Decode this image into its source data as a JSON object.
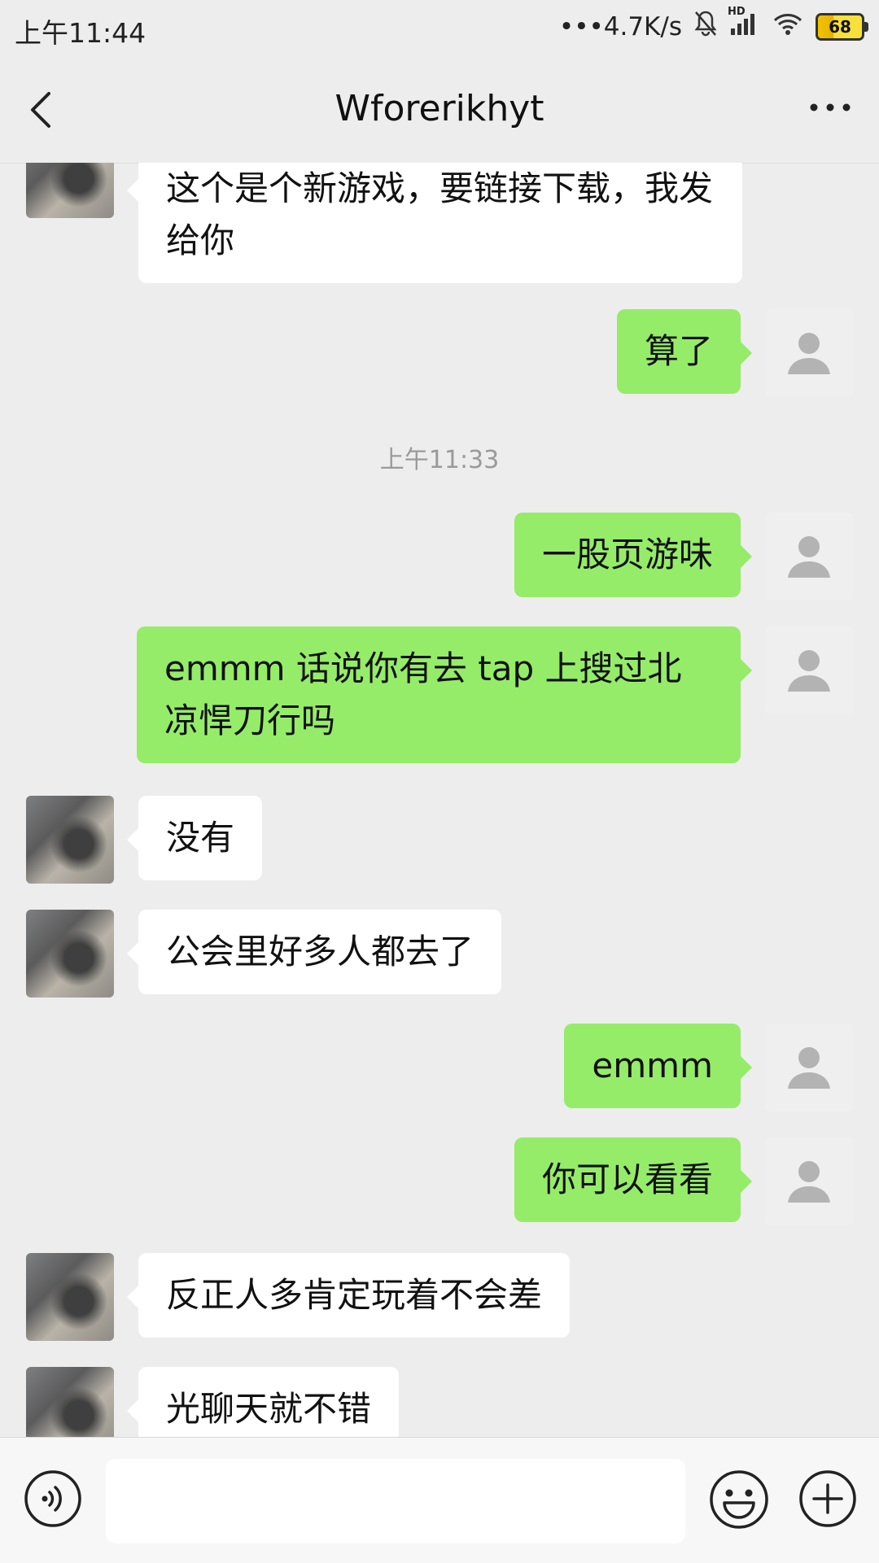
{
  "status": {
    "time": "上午11:44",
    "speed": "•••4.7K/s",
    "hd": "HD",
    "battery": "68"
  },
  "header": {
    "title": "Wforerikhyt"
  },
  "messages": [
    {
      "side": "left",
      "text": "这个是个新游戏，要链接下载，我发给你"
    },
    {
      "side": "right",
      "text": "算了"
    },
    {
      "timestamp": "上午11:33"
    },
    {
      "side": "right",
      "text": "一股页游味"
    },
    {
      "side": "right",
      "text": "emmm  话说你有去 tap 上搜过北凉悍刀行吗"
    },
    {
      "side": "left",
      "text": "没有"
    },
    {
      "side": "left",
      "text": "公会里好多人都去了"
    },
    {
      "side": "right",
      "text": "emmm"
    },
    {
      "side": "right",
      "text": "你可以看看"
    },
    {
      "side": "left",
      "text": "反正人多肯定玩着不会差"
    },
    {
      "side": "left",
      "text": "光聊天就不错"
    }
  ],
  "input": {
    "placeholder": ""
  }
}
